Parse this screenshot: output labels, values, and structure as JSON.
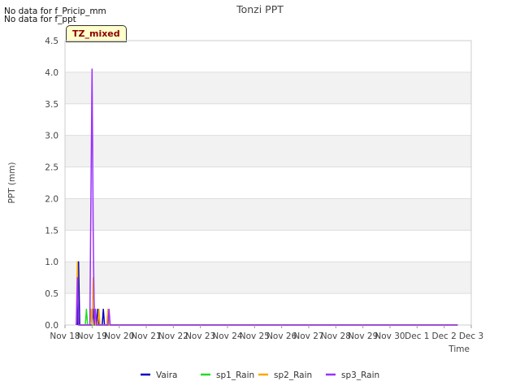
{
  "notes": [
    "No data for f_Pricip_mm",
    "No data for f_ppt"
  ],
  "badge": "TZ_mixed",
  "chart_data": {
    "type": "line",
    "title": "Tonzi PPT",
    "xlabel": "Time",
    "ylabel": "PPT (mm)",
    "ylim": [
      0,
      4.5
    ],
    "yticks": [
      "0.0",
      "0.5",
      "1.0",
      "1.5",
      "2.0",
      "2.5",
      "3.0",
      "3.5",
      "4.0",
      "4.5"
    ],
    "xlim": [
      "2023-11-18",
      "2023-12-03"
    ],
    "xtick_labels": [
      "Nov 18",
      "Nov 19",
      "Nov 20",
      "Nov 21",
      "Nov 22",
      "Nov 23",
      "Nov 24",
      "Nov 25",
      "Nov 26",
      "Nov 27",
      "Nov 28",
      "Nov 29",
      "Nov 30",
      "Dec 1",
      "Dec 2",
      "Dec 3"
    ],
    "grid": true,
    "legend_position": "bottom",
    "series": [
      {
        "name": "Vaira",
        "color": "#0000bb",
        "points": [
          [
            "2023-11-18 11:00",
            0
          ],
          [
            "2023-11-18 12:00",
            1.0
          ],
          [
            "2023-11-18 13:00",
            0
          ],
          [
            "2023-11-19 00:00",
            0
          ],
          [
            "2023-11-19 01:00",
            0.25
          ],
          [
            "2023-11-19 02:00",
            0
          ],
          [
            "2023-11-19 04:00",
            0
          ],
          [
            "2023-11-19 05:00",
            0.25
          ],
          [
            "2023-11-19 06:00",
            0
          ],
          [
            "2023-11-19 09:00",
            0
          ],
          [
            "2023-11-19 10:00",
            0.25
          ],
          [
            "2023-11-19 11:00",
            0
          ],
          [
            "2023-12-02 12:00",
            0
          ]
        ]
      },
      {
        "name": "sp1_Rain",
        "color": "#22dd22",
        "points": [
          [
            "2023-11-18 18:00",
            0
          ],
          [
            "2023-11-18 19:00",
            0.25
          ],
          [
            "2023-11-18 20:00",
            0
          ],
          [
            "2023-11-18 22:00",
            0
          ],
          [
            "2023-11-18 23:00",
            0.25
          ],
          [
            "2023-11-19 00:00",
            0
          ],
          [
            "2023-12-02 12:00",
            0
          ]
        ]
      },
      {
        "name": "sp2_Rain",
        "color": "#ffa500",
        "points": [
          [
            "2023-11-18 10:00",
            0
          ],
          [
            "2023-11-18 11:00",
            1.0
          ],
          [
            "2023-11-18 12:00",
            0
          ],
          [
            "2023-11-18 22:00",
            0
          ],
          [
            "2023-11-18 23:00",
            0.25
          ],
          [
            "2023-11-19 00:00",
            0
          ],
          [
            "2023-11-19 01:00",
            0.75
          ],
          [
            "2023-11-19 02:00",
            0.25
          ],
          [
            "2023-11-19 03:00",
            0
          ],
          [
            "2023-11-19 05:00",
            0
          ],
          [
            "2023-11-19 06:00",
            0.25
          ],
          [
            "2023-11-19 07:00",
            0
          ],
          [
            "2023-11-19 13:00",
            0
          ],
          [
            "2023-11-19 14:00",
            0.25
          ],
          [
            "2023-11-19 15:00",
            0
          ],
          [
            "2023-12-02 12:00",
            0
          ]
        ]
      },
      {
        "name": "sp3_Rain",
        "color": "#9b30ff",
        "points": [
          [
            "2023-11-18 10:00",
            0
          ],
          [
            "2023-11-18 11:00",
            0.75
          ],
          [
            "2023-11-18 12:00",
            0
          ],
          [
            "2023-11-18 22:00",
            0
          ],
          [
            "2023-11-18 23:00",
            2.0
          ],
          [
            "2023-11-19 00:00",
            4.05
          ],
          [
            "2023-11-19 01:00",
            1.5
          ],
          [
            "2023-11-19 02:00",
            0
          ],
          [
            "2023-11-19 03:00",
            0.25
          ],
          [
            "2023-11-19 04:00",
            0
          ],
          [
            "2023-11-19 14:00",
            0
          ],
          [
            "2023-11-19 15:00",
            0.25
          ],
          [
            "2023-11-19 16:00",
            0
          ],
          [
            "2023-12-02 12:00",
            0
          ]
        ]
      }
    ]
  }
}
